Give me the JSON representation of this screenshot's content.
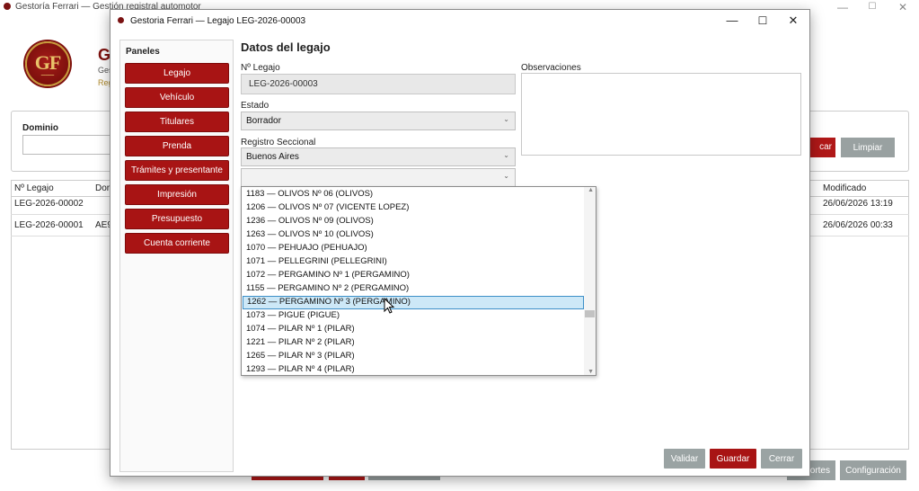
{
  "main_window": {
    "title": "Gestoría Ferrari — Gestión registral automotor",
    "controls": {
      "minimize": "—",
      "maximize": "☐",
      "close": "✕"
    },
    "logo_text": "GF",
    "heading_letter": "G",
    "sub1": "Ges",
    "sub2": "Reg",
    "search": {
      "dominio_label": "Dominio",
      "buscar_label": "car",
      "limpiar_label": "Limpiar"
    },
    "table": {
      "columns": [
        "Nº Legajo",
        "Dor",
        "Modificado"
      ],
      "rows": [
        {
          "legajo": "LEG-2026-00002",
          "dominio": "",
          "modificado": "26/06/2026 13:19"
        },
        {
          "legajo": "LEG-2026-00001",
          "dominio": "AE9",
          "modificado": "26/06/2026 00:33"
        }
      ]
    },
    "bottom_buttons": {
      "reportes": "ortes",
      "configuracion": "Configuración"
    }
  },
  "dialog": {
    "title": "Gestoria Ferrari — Legajo LEG-2026-00003",
    "controls": {
      "minimize": "—",
      "maximize": "☐",
      "close": "✕"
    },
    "panels_title": "Paneles",
    "panels": [
      "Legajo",
      "Vehículo",
      "Titulares",
      "Prenda",
      "Trámites y presentante",
      "Impresión",
      "Presupuesto",
      "Cuenta corriente"
    ],
    "section_title": "Datos del legajo",
    "fields": {
      "legajo_label": "Nº Legajo",
      "legajo_value": "LEG-2026-00003",
      "estado_label": "Estado",
      "estado_value": "Borrador",
      "registro_label": "Registro Seccional",
      "registro_value": "Buenos Aires",
      "registro2_value": "",
      "observaciones_label": "Observaciones"
    },
    "dropdown_items": [
      "1183 — OLIVOS Nº 06 (OLIVOS)",
      "1206 — OLIVOS Nº 07 (VICENTE LOPEZ)",
      "1236 — OLIVOS Nº 09 (OLIVOS)",
      "1263 — OLIVOS Nº 10 (OLIVOS)",
      "1070 — PEHUAJO (PEHUAJO)",
      "1071 — PELLEGRINI (PELLEGRINI)",
      "1072 — PERGAMINO Nº 1 (PERGAMINO)",
      "1155 — PERGAMINO Nº 2 (PERGAMINO)",
      "1262 — PERGAMINO Nº 3 (PERGAMINO)",
      "1073 — PIGUE (PIGUE)",
      "1074 — PILAR Nº 1 (PILAR)",
      "1221 — PILAR Nº 2 (PILAR)",
      "1265 — PILAR Nº 3 (PILAR)",
      "1293 — PILAR Nº 4 (PILAR)"
    ],
    "selected_index": 8,
    "buttons": {
      "validar": "Validar",
      "guardar": "Guardar",
      "cerrar": "Cerrar"
    }
  },
  "colors": {
    "brand_red": "#a81414",
    "grey_button": "#99a1a1",
    "selection": "#cde8f7"
  }
}
